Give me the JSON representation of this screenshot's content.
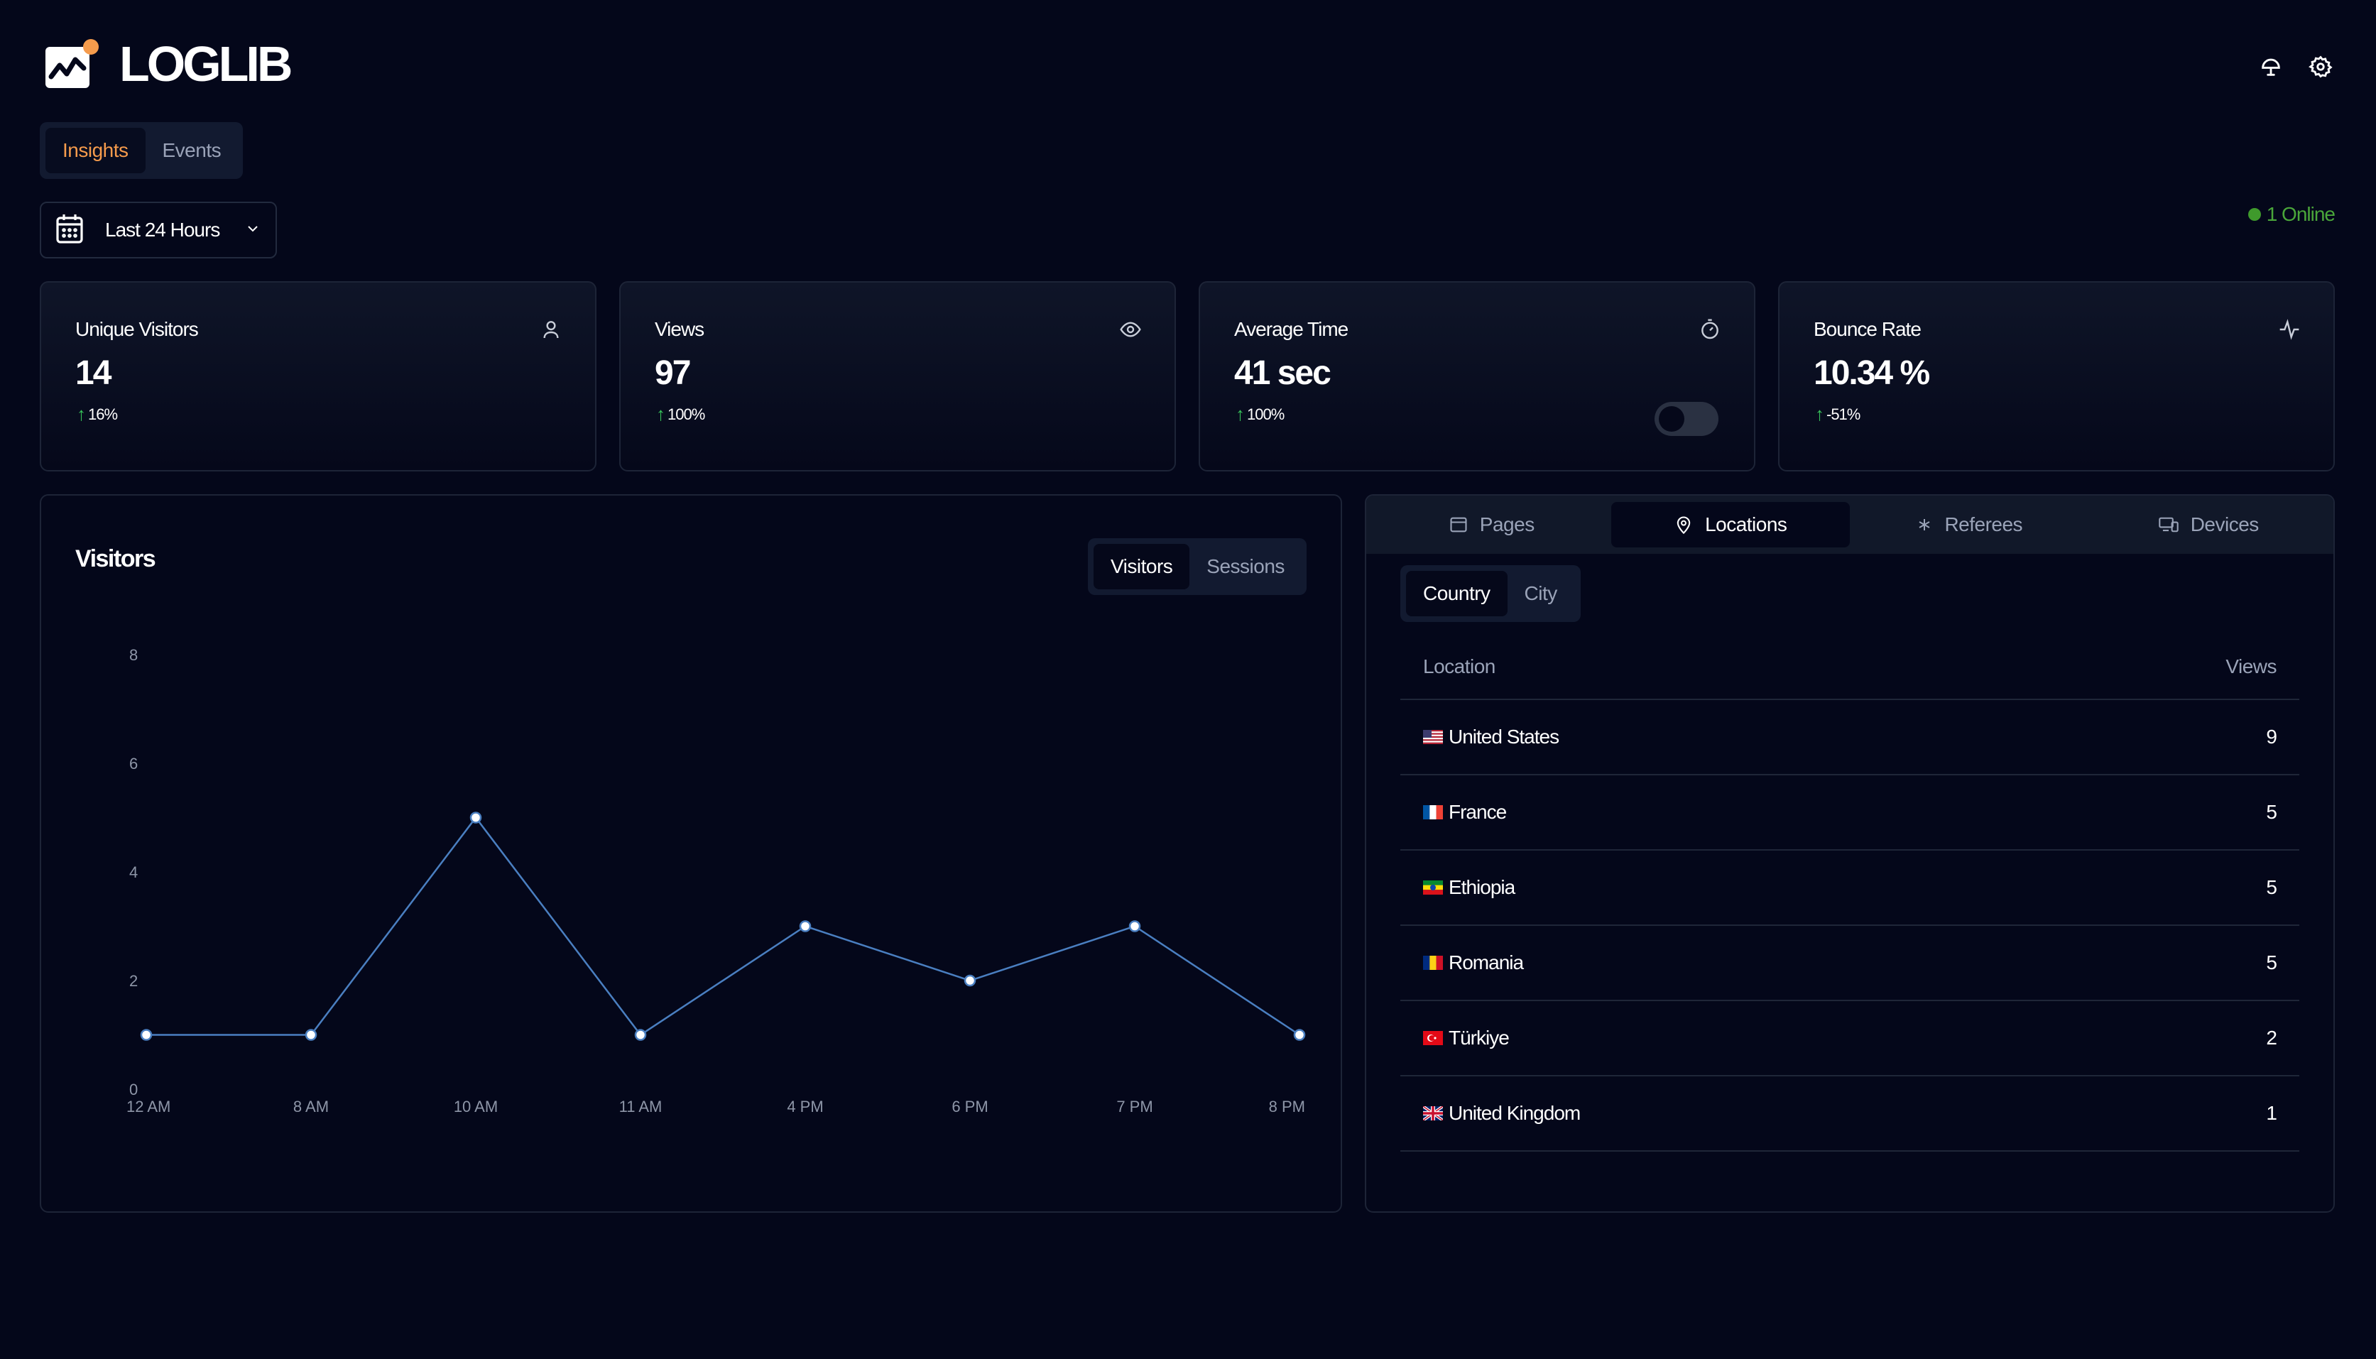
{
  "app": {
    "name": "LOGLIB"
  },
  "tabs": {
    "insights": "Insights",
    "events": "Events"
  },
  "date_range": {
    "label": "Last 24 Hours"
  },
  "online": "1 Online",
  "stats": [
    {
      "title": "Unique Visitors",
      "value": "14",
      "change": "16%",
      "icon": "user-icon"
    },
    {
      "title": "Views",
      "value": "97",
      "change": "100%",
      "icon": "eye-icon"
    },
    {
      "title": "Average Time",
      "value": "41 sec",
      "change": "100%",
      "icon": "timer-icon"
    },
    {
      "title": "Bounce Rate",
      "value": "10.34 %",
      "change": "-51%",
      "icon": "activity-icon"
    }
  ],
  "chart_panel": {
    "title": "Visitors",
    "toggle": {
      "visitors": "Visitors",
      "sessions": "Sessions"
    }
  },
  "chart_data": {
    "type": "line",
    "categories": [
      "12 AM",
      "8 AM",
      "10 AM",
      "11 AM",
      "4 PM",
      "6 PM",
      "7 PM",
      "8 PM"
    ],
    "series": [
      {
        "values": [
          1,
          1,
          5,
          1,
          3,
          2,
          3,
          1
        ]
      }
    ],
    "yticks": [
      "0",
      "2",
      "4",
      "6",
      "8"
    ],
    "ylim": [
      0,
      8
    ],
    "line_color": "#4a7fc1",
    "grid": false
  },
  "location_panel": {
    "tabs": {
      "pages": "Pages",
      "locations": "Locations",
      "referees": "Referees",
      "devices": "Devices"
    },
    "sub_tabs": {
      "country": "Country",
      "city": "City"
    },
    "columns": {
      "location": "Location",
      "views": "Views"
    },
    "rows": [
      {
        "name": "United States",
        "views": "9",
        "flag": "us"
      },
      {
        "name": "France",
        "views": "5",
        "flag": "fr"
      },
      {
        "name": "Ethiopia",
        "views": "5",
        "flag": "et"
      },
      {
        "name": "Romania",
        "views": "5",
        "flag": "ro"
      },
      {
        "name": "Türkiye",
        "views": "2",
        "flag": "tr"
      },
      {
        "name": "United Kingdom",
        "views": "1",
        "flag": "gb"
      }
    ]
  },
  "colors": {
    "background": "#04071a",
    "accent": "#f59b4c",
    "positive": "#37c45a",
    "online": "#3f9a2c"
  }
}
